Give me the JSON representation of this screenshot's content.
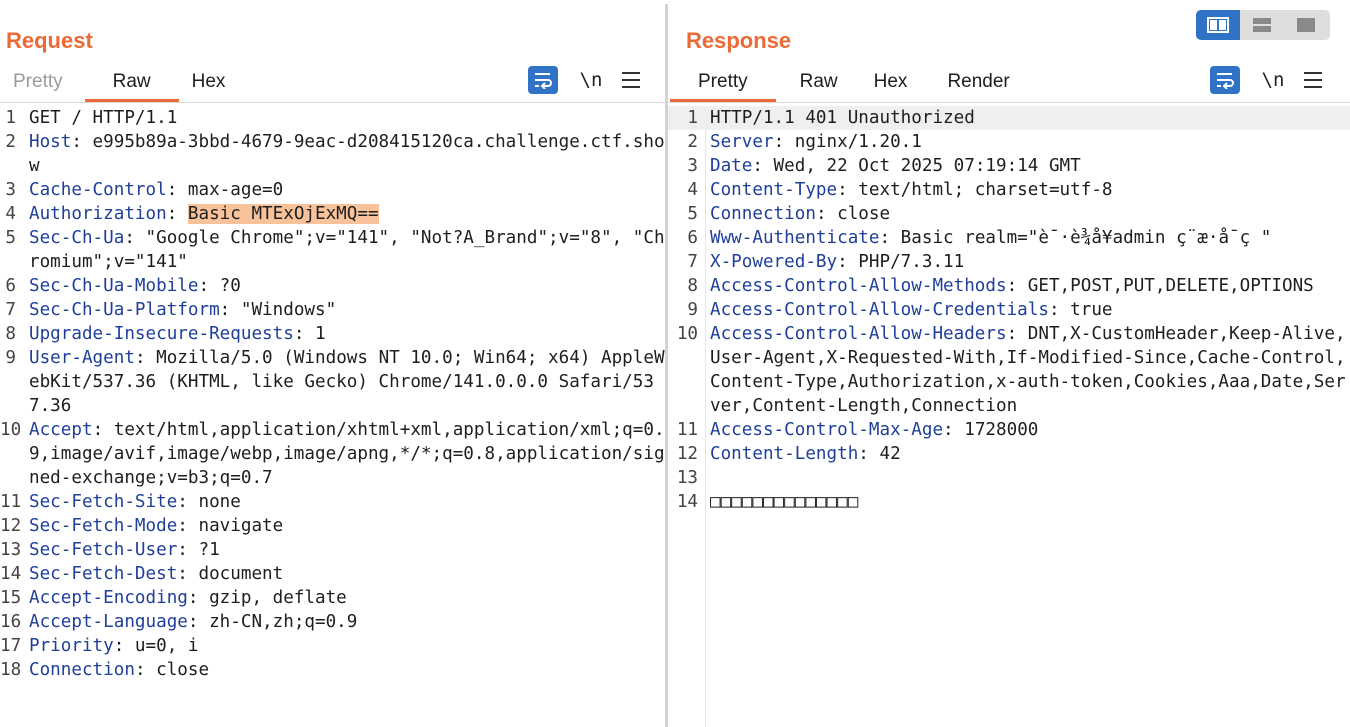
{
  "request": {
    "title": "Request",
    "tabs": [
      {
        "label": "Pretty"
      },
      {
        "label": "Raw"
      },
      {
        "label": "Hex"
      }
    ],
    "newline_label": "\\n",
    "lines": [
      {
        "num": "1",
        "name": "",
        "sep": "",
        "value": "GET / HTTP/1.1"
      },
      {
        "num": "2",
        "name": "Host",
        "sep": ":",
        "value": " e995b89a-3bbd-4679-9eac-d208415120ca.challenge.ctf.show"
      },
      {
        "num": "3",
        "name": "Cache-Control",
        "sep": ":",
        "value": " max-age=0"
      },
      {
        "num": "4",
        "name": "Authorization",
        "sep": ":",
        "value": " ",
        "highlight": "Basic MTExOjExMQ=="
      },
      {
        "num": "5",
        "name": "Sec-Ch-Ua",
        "sep": ":",
        "value": " \"Google Chrome\";v=\"141\", \"Not?A_Brand\";v=\"8\", \"Chromium\";v=\"141\""
      },
      {
        "num": "6",
        "name": "Sec-Ch-Ua-Mobile",
        "sep": ":",
        "value": " ?0"
      },
      {
        "num": "7",
        "name": "Sec-Ch-Ua-Platform",
        "sep": ":",
        "value": " \"Windows\""
      },
      {
        "num": "8",
        "name": "Upgrade-Insecure-Requests",
        "sep": ":",
        "value": " 1"
      },
      {
        "num": "9",
        "name": "User-Agent",
        "sep": ":",
        "value": " Mozilla/5.0 (Windows NT 10.0; Win64; x64) AppleWebKit/537.36 (KHTML, like Gecko) Chrome/141.0.0.0 Safari/537.36"
      },
      {
        "num": "10",
        "name": "Accept",
        "sep": ":",
        "value": " text/html,application/xhtml+xml,application/xml;q=0.9,image/avif,image/webp,image/apng,*/*;q=0.8,application/signed-exchange;v=b3;q=0.7"
      },
      {
        "num": "11",
        "name": "Sec-Fetch-Site",
        "sep": ":",
        "value": " none"
      },
      {
        "num": "12",
        "name": "Sec-Fetch-Mode",
        "sep": ":",
        "value": " navigate"
      },
      {
        "num": "13",
        "name": "Sec-Fetch-User",
        "sep": ":",
        "value": " ?1"
      },
      {
        "num": "14",
        "name": "Sec-Fetch-Dest",
        "sep": ":",
        "value": " document"
      },
      {
        "num": "15",
        "name": "Accept-Encoding",
        "sep": ":",
        "value": " gzip, deflate"
      },
      {
        "num": "16",
        "name": "Accept-Language",
        "sep": ":",
        "value": " zh-CN,zh;q=0.9"
      },
      {
        "num": "17",
        "name": "Priority",
        "sep": ":",
        "value": " u=0, i"
      },
      {
        "num": "18",
        "name": "Connection",
        "sep": ":",
        "value": " close"
      }
    ]
  },
  "response": {
    "title": "Response",
    "tabs": [
      {
        "label": "Pretty"
      },
      {
        "label": "Raw"
      },
      {
        "label": "Hex"
      },
      {
        "label": "Render"
      }
    ],
    "newline_label": "\\n",
    "lines": [
      {
        "num": "1",
        "name": "",
        "sep": "",
        "value": "HTTP/1.1 401 Unauthorized"
      },
      {
        "num": "2",
        "name": "Server",
        "sep": ":",
        "value": " nginx/1.20.1"
      },
      {
        "num": "3",
        "name": "Date",
        "sep": ":",
        "value": " Wed, 22 Oct 2025 07:19:14 GMT"
      },
      {
        "num": "4",
        "name": "Content-Type",
        "sep": ":",
        "value": " text/html; charset=utf-8"
      },
      {
        "num": "5",
        "name": "Connection",
        "sep": ":",
        "value": " close"
      },
      {
        "num": "6",
        "name": "Www-Authenticate",
        "sep": ":",
        "value": " Basic realm=\"è¯·è¾å¥admin ç¨æ·å¯ç \""
      },
      {
        "num": "7",
        "name": "X-Powered-By",
        "sep": ":",
        "value": " PHP/7.3.11"
      },
      {
        "num": "8",
        "name": "Access-Control-Allow-Methods",
        "sep": ":",
        "value": " GET,POST,PUT,DELETE,OPTIONS"
      },
      {
        "num": "9",
        "name": "Access-Control-Allow-Credentials",
        "sep": ":",
        "value": " true"
      },
      {
        "num": "10",
        "name": "Access-Control-Allow-Headers",
        "sep": ":",
        "value": " DNT,X-CustomHeader,Keep-Alive,User-Agent,X-Requested-With,If-Modified-Since,Cache-Control,Content-Type,Authorization,x-auth-token,Cookies,Aaa,Date,Server,Content-Length,Connection"
      },
      {
        "num": "11",
        "name": "Access-Control-Max-Age",
        "sep": ":",
        "value": " 1728000"
      },
      {
        "num": "12",
        "name": "Content-Length",
        "sep": ":",
        "value": " 42"
      },
      {
        "num": "13",
        "name": "",
        "sep": "",
        "value": ""
      },
      {
        "num": "14",
        "name": "",
        "sep": "",
        "value": "□□□□□□□□□□□□□□"
      }
    ]
  },
  "icons": {
    "wrap": "wrap-lines-icon",
    "menu": "hamburger-menu-icon",
    "layout": [
      "side-by-side-layout-icon",
      "top-bottom-layout-icon",
      "single-pane-layout-icon"
    ]
  },
  "colors": {
    "accent": "#ec6a36",
    "header_name": "#1f3f99",
    "highlight": "#f8c39b",
    "button_blue": "#2f72c6"
  }
}
